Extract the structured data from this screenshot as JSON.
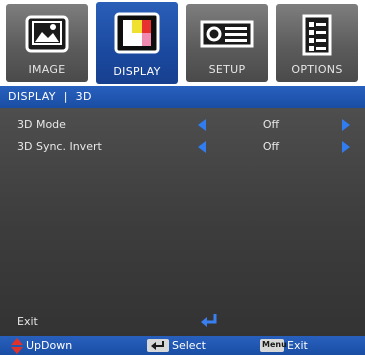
{
  "tabs": [
    {
      "label": "IMAGE",
      "icon": "image-picture-icon",
      "active": false
    },
    {
      "label": "DISPLAY",
      "icon": "display-color-bars-icon",
      "active": true
    },
    {
      "label": "SETUP",
      "icon": "projector-setup-icon",
      "active": false
    },
    {
      "label": "OPTIONS",
      "icon": "options-checklist-icon",
      "active": false
    }
  ],
  "breadcrumb": "DISPLAY  |  3D",
  "menu": {
    "items": [
      {
        "label": "3D Mode",
        "value": "Off"
      },
      {
        "label": "3D Sync. Invert",
        "value": "Off"
      }
    ],
    "exit_label": "Exit"
  },
  "footer": {
    "updown_label": "UpDown",
    "select_label": "Select",
    "menu_key_label": "Menu",
    "exit_label": "Exit"
  },
  "colors": {
    "accent_blue": "#1b49a0",
    "arrow_blue": "#2f7df0",
    "enter_blue": "#3a7ff0",
    "tab_gray": "#5c5c5c",
    "body_gray": "#3d3d3d",
    "updown_red": "#e0322a"
  }
}
